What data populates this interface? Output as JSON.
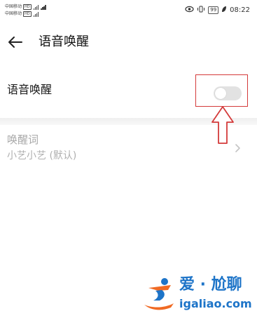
{
  "status_bar": {
    "carrier_1": "中国移动",
    "carrier_2": "中国移动",
    "network_badge": "HD",
    "battery_level": "99",
    "time": "08:22",
    "icons": [
      "eye-comfort-icon",
      "vibrate-icon",
      "battery-icon",
      "leaf-icon"
    ]
  },
  "header": {
    "title": "语音唤醒",
    "back_icon": "arrow-left-icon"
  },
  "settings": {
    "voice_wakeup": {
      "label": "语音唤醒",
      "enabled": false
    },
    "wake_word": {
      "title": "唤醒词",
      "value": "小艺小艺 (默认)"
    }
  },
  "annotation": {
    "color": "#d43a3a",
    "shape": "highlight-box-with-up-arrow"
  },
  "watermark": {
    "brand": "爱 · 尬聊",
    "url": "igaliao.com",
    "color": "#1d74c8"
  },
  "colors": {
    "toggle_off_track": "#e2e2e2",
    "disabled_text": "#a8a8a8"
  }
}
